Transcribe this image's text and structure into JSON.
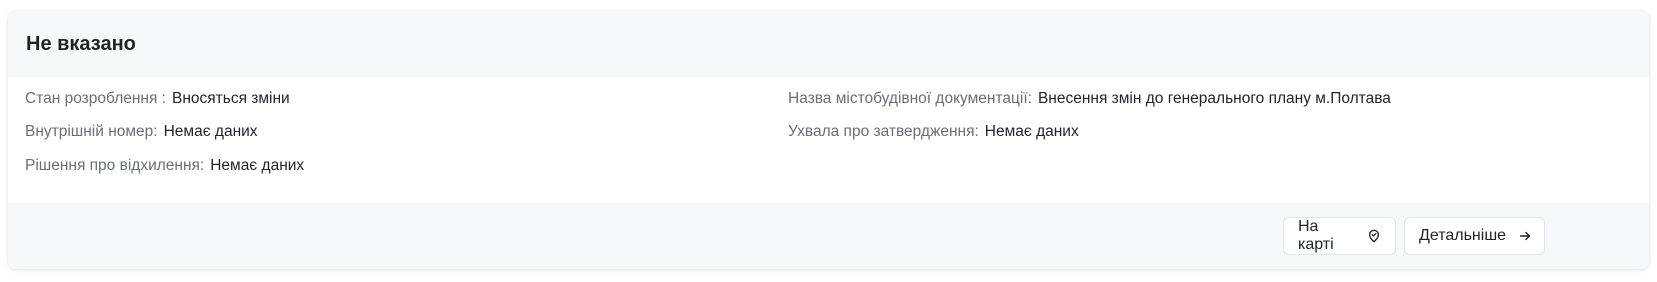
{
  "card": {
    "title": "Не вказано",
    "fields": {
      "status": {
        "label": "Стан розроблення :",
        "value": "Вносяться зміни"
      },
      "doc_name": {
        "label": "Назва містобудівної документації:",
        "value": "Внесення змін до генерального плану м.Полтава"
      },
      "internal_number": {
        "label": "Внутрішній номер:",
        "value": "Немає даних"
      },
      "approval_resolution": {
        "label": "Ухвала про затвердження:",
        "value": "Немає даних"
      },
      "rejection_decision": {
        "label": "Рішення про відхилення:",
        "value": "Немає даних"
      }
    },
    "buttons": {
      "map_label": "На карті",
      "details_label": "Детальніше"
    },
    "icons": {
      "map": "map-pin-check-icon",
      "details": "arrow-right-icon"
    }
  }
}
